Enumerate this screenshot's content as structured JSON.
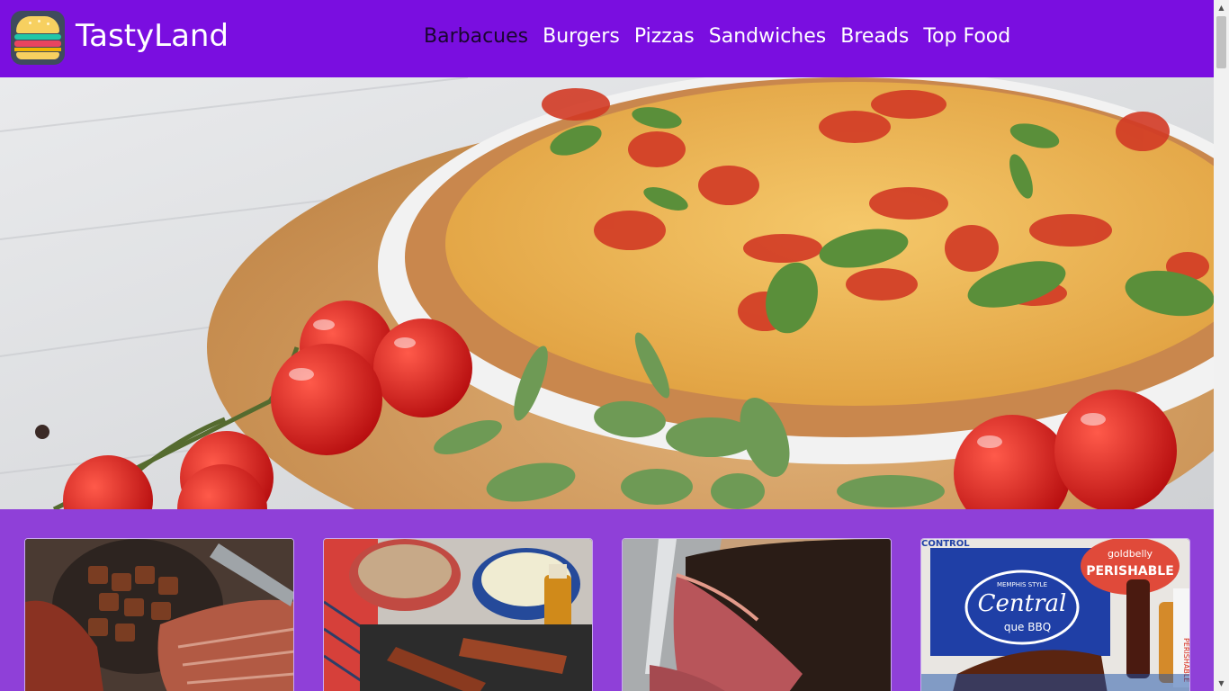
{
  "header": {
    "brand": "TastyLand",
    "logo_icon": "burger-icon",
    "nav": [
      {
        "label": "Barbacues",
        "active": true
      },
      {
        "label": "Burgers"
      },
      {
        "label": "Pizzas"
      },
      {
        "label": "Sandwiches"
      },
      {
        "label": "Breads"
      },
      {
        "label": "Top Food"
      }
    ]
  },
  "hero": {
    "image": "pizza-hero-image"
  },
  "cards": [
    {
      "image": "bbq-brisket-burnt-ends-image"
    },
    {
      "image": "bbq-ribs-sides-image"
    },
    {
      "image": "smoked-brisket-image"
    },
    {
      "image": "central-bbq-ribs-image",
      "labels": [
        "CONTROL",
        "Central",
        "MEMPHIS STYLE",
        "que BBQ",
        "goldbelly",
        "PERISHABLE",
        "PERISHABLE"
      ]
    }
  ],
  "colors": {
    "header_bg": "#7a0ee0",
    "page_bg": "#8f40d8",
    "nav_text": "#ffffff",
    "nav_active": "#1a0630"
  }
}
